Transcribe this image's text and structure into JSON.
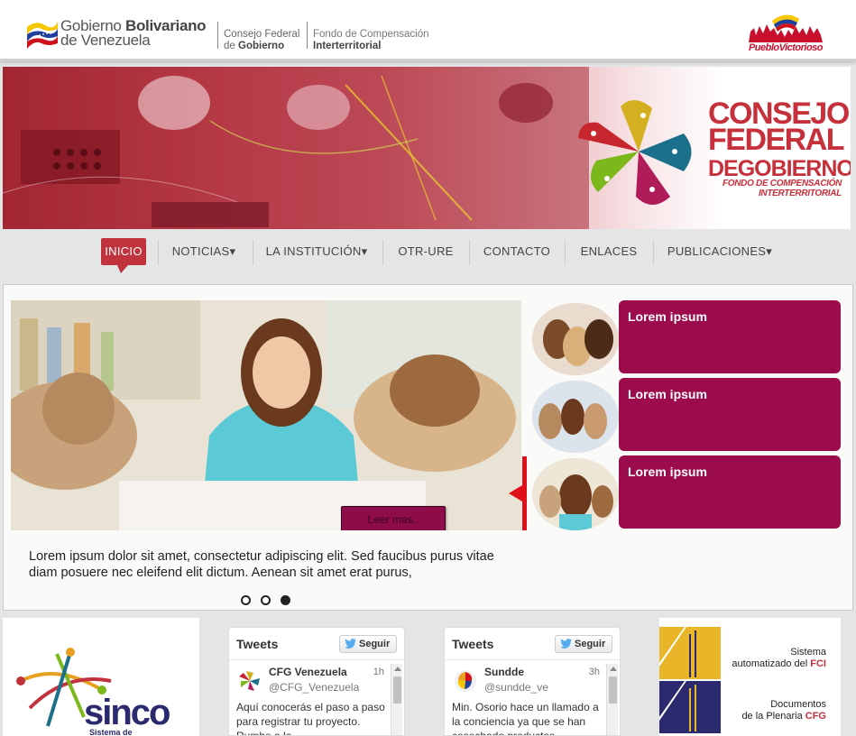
{
  "header": {
    "gov_name_light": "Gobierno",
    "gov_name_bold": "Bolivariano",
    "gov_name_line2": "de Venezuela",
    "cfg_line1": "Consejo Federal",
    "cfg_line2_prefix": "de ",
    "cfg_line2_bold": "Gobierno",
    "fci_line1": "Fondo de Compensación",
    "fci_line2": "Interterritorial",
    "slogan": "PuebloVictorioso"
  },
  "banner": {
    "title_line1": "CONSEJO",
    "title_line2": "FEDERAL",
    "title_line3_small": "DE",
    "title_line3": "GOBIERNO",
    "subtitle_line1": "FONDO DE COMPENSACIÓN",
    "subtitle_line2": "INTERTERRITORIAL"
  },
  "nav": {
    "items": [
      {
        "label": "INICIO"
      },
      {
        "label": "NOTICIAS▾"
      },
      {
        "label": "LA INSTITUCIÓN▾"
      },
      {
        "label": "OTR-URE"
      },
      {
        "label": "CONTACTO"
      },
      {
        "label": "ENLACES"
      },
      {
        "label": "PUBLICACIONES▾"
      }
    ]
  },
  "slider": {
    "read_more": "Leer mas..",
    "caption": "Lorem ipsum dolor sit amet, consectetur adipiscing elit. Sed faucibus purus vitae diam posuere nec eleifend elit dictum. Aenean sit amet erat purus,",
    "side_items": [
      {
        "title": "Lorem ipsum"
      },
      {
        "title": "Lorem ipsum"
      },
      {
        "title": "Lorem ipsum"
      }
    ],
    "dots": {
      "count": 3,
      "active_index": 2
    }
  },
  "sinco": {
    "logo_text": "sinco",
    "logo_subtext": "Sistema de"
  },
  "tweets": [
    {
      "heading": "Tweets",
      "follow": "Seguir",
      "name": "CFG Venezuela",
      "handle": "@CFG_Venezuela",
      "time": "1h",
      "text": "Aquí conocerás el paso a paso para registrar tu proyecto. Rumbo a la"
    },
    {
      "heading": "Tweets",
      "follow": "Seguir",
      "name": "Sundde",
      "handle": "@sundde_ve",
      "time": "3h",
      "text": "Min. Osorio hace un llamado a la conciencia ya que se han cosechado productos"
    }
  ],
  "links": [
    {
      "line1": "Sistema",
      "line2_prefix": "automatizado del ",
      "line2_bold": "FCI"
    },
    {
      "line1": "Documentos",
      "line2_prefix": "de la Plenaria ",
      "line2_bold": "CFG"
    }
  ],
  "colors": {
    "accent_red": "#c0323c",
    "slider_magenta": "#9c0b4c",
    "twitter_blue": "#55acee"
  }
}
